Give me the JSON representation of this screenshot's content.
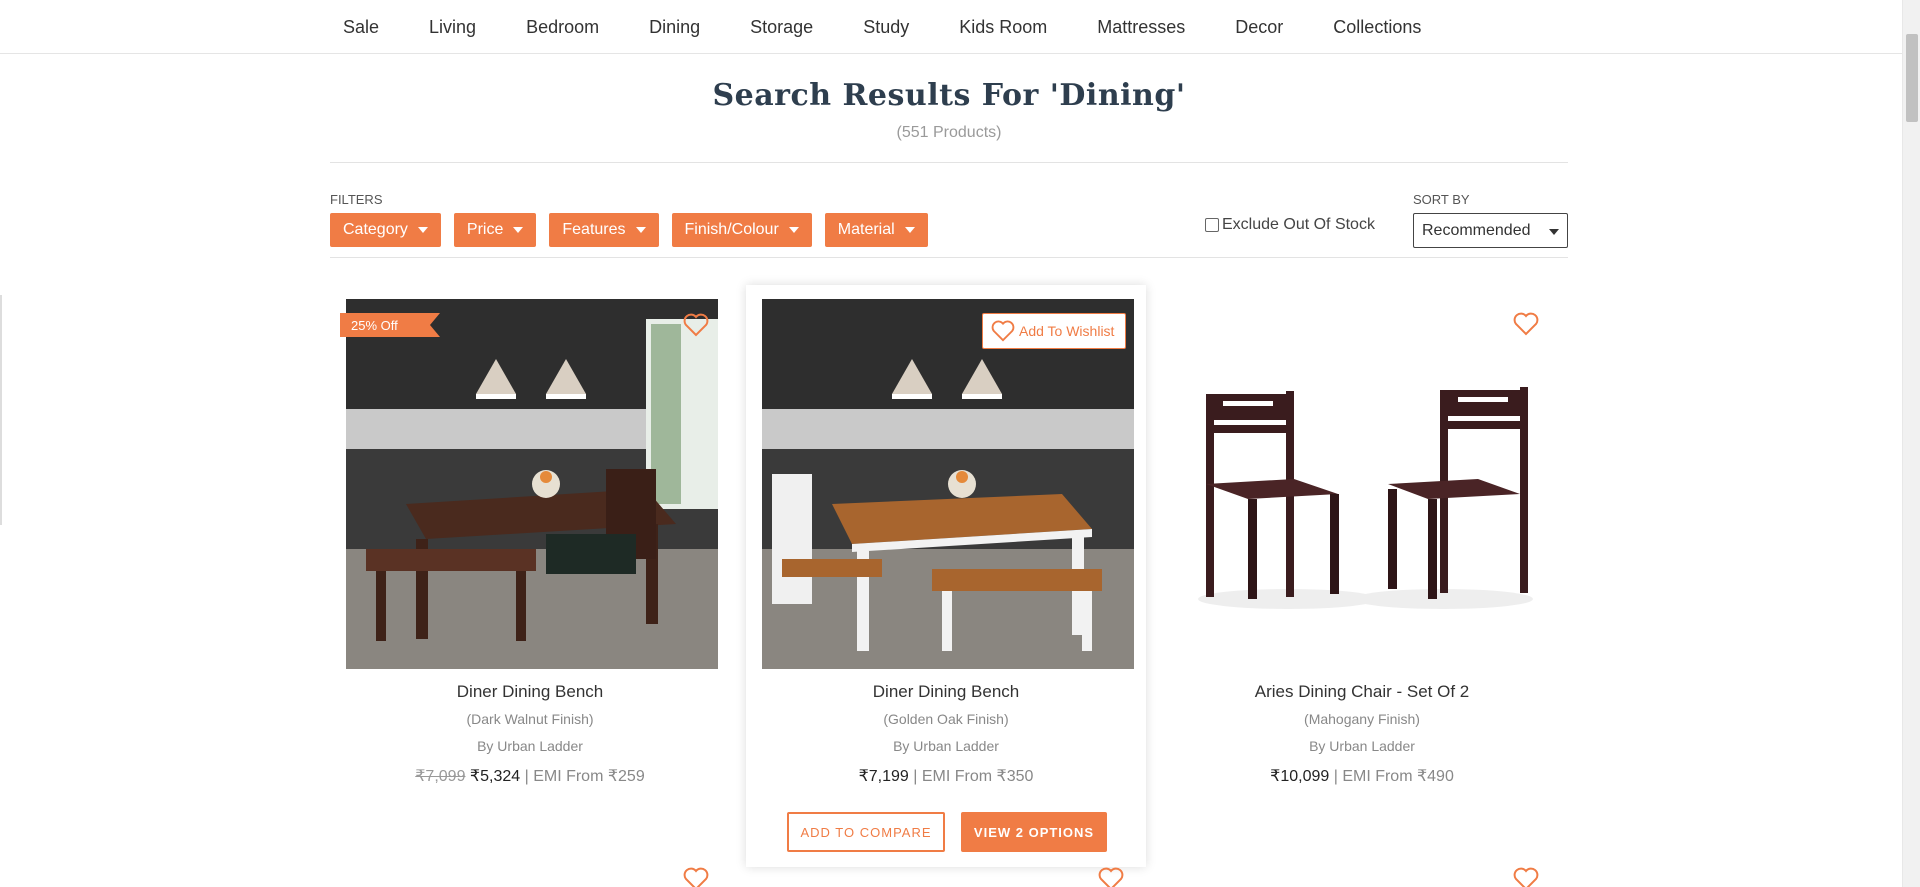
{
  "nav": {
    "items": [
      "Sale",
      "Living",
      "Bedroom",
      "Dining",
      "Storage",
      "Study",
      "Kids Room",
      "Mattresses",
      "Decor",
      "Collections"
    ]
  },
  "search": {
    "title": "Search Results For 'Dining'",
    "count": "(551 Products)"
  },
  "filters": {
    "label": "FILTERS",
    "buttons": [
      "Category",
      "Price",
      "Features",
      "Finish/Colour",
      "Material"
    ],
    "exclude_label": "Exclude Out Of Stock"
  },
  "sort": {
    "label": "SORT BY",
    "selected": "Recommended"
  },
  "products": [
    {
      "name": "Diner Dining Bench",
      "finish": "(Dark Walnut Finish)",
      "brand": "By Urban Ladder",
      "mrp": "₹7,099",
      "price": "₹5,324",
      "emi": " | EMI From ₹259",
      "badge": "25% Off"
    },
    {
      "name": "Diner Dining Bench",
      "finish": "(Golden Oak Finish)",
      "brand": "By Urban Ladder",
      "price": "₹7,199",
      "emi": " | EMI From ₹350",
      "wishlist": "Add To Wishlist",
      "compare": "ADD TO COMPARE",
      "options": "VIEW 2 OPTIONS"
    },
    {
      "name": "Aries Dining Chair - Set Of 2",
      "finish": "(Mahogany Finish)",
      "brand": "By Urban Ladder",
      "price": "₹10,099",
      "emi": " | EMI From ₹490"
    }
  ],
  "colors": {
    "accent": "#f07c45",
    "title": "#2e3e4e"
  }
}
